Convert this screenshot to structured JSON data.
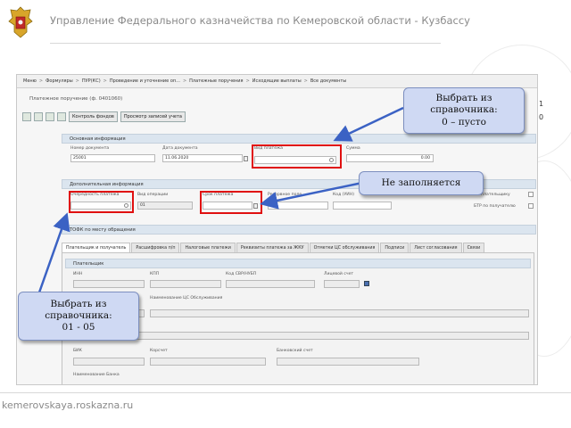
{
  "header": {
    "title": "Управление Федерального казначейства по Кемеровской области - Кузбассу"
  },
  "footer": {
    "url": "kemerovskaya.roskazna.ru"
  },
  "breadcrumbs": [
    "Меню",
    "Формуляры",
    "ПУР(КС)",
    "Проведение и уточнение оп...",
    "Платежные поручения",
    "Исходящие выплаты",
    "Все документы"
  ],
  "document": {
    "title": "Платежное поручение (ф. 0401060)"
  },
  "toolbar": {
    "control_label": "Контроль фондов",
    "view_label": "Просмотр записей учета"
  },
  "sections": {
    "main_info": "Основная информация",
    "additional_info": "Дополнительная информация",
    "tofk": "ТОФК по месту обращения"
  },
  "fields": {
    "doc_number": {
      "label": "Номер документа",
      "value": "25001"
    },
    "doc_date": {
      "label": "Дата документа",
      "value": "11.06.2020"
    },
    "payment_type": {
      "label": "Вид платежа",
      "value": ""
    },
    "amount": {
      "label": "Сумма",
      "value": "0.00"
    },
    "priority": {
      "label": "Очередность платежа",
      "value": ""
    },
    "operation_type": {
      "label": "Вид операции",
      "value": "01"
    },
    "payment_term": {
      "label": "Срок платежа",
      "value": ""
    },
    "reserve_field": {
      "label": "Резервное поле",
      "value": ""
    },
    "uin_code": {
      "label": "Код (УИН)",
      "value": ""
    },
    "bank_pay": {
      "label": "БН плательщику"
    },
    "btr_recv": {
      "label": "БТР по получателю"
    }
  },
  "tabs": [
    "Плательщик и получатель",
    "Расшифровка п/п",
    "Налоговые платежи",
    "Реквизиты платежа за ЖКУ",
    "Отметки ЦС обслуживания",
    "Подписи",
    "Лист согласования",
    "Связи"
  ],
  "payer_panel": {
    "heading": "Плательщик",
    "inn": "ИНН",
    "kpp": "КПП",
    "svr_code": "Код СВР/НУБП",
    "account": "Лицевой счет",
    "service_name": "Наименование ЦС Обслуживания",
    "bik": "БИК",
    "corr": "Корсчет",
    "bank_account": "Банковский счет",
    "bank_name": "Наименование Банка"
  },
  "callouts": {
    "payment_type_hint": "Выбрать из справочника:\n0 – пусто",
    "term_hint": "Не заполняется",
    "priority_hint": "Выбрать из справочника:\n01 - 05"
  },
  "right_col": {
    "value1": "1",
    "value2": "0"
  },
  "colors": {
    "highlight": "#e01010",
    "arrow": "#3b62c4",
    "callout_bg": "#cfd9f3",
    "section_header": "#dbe5ef"
  }
}
